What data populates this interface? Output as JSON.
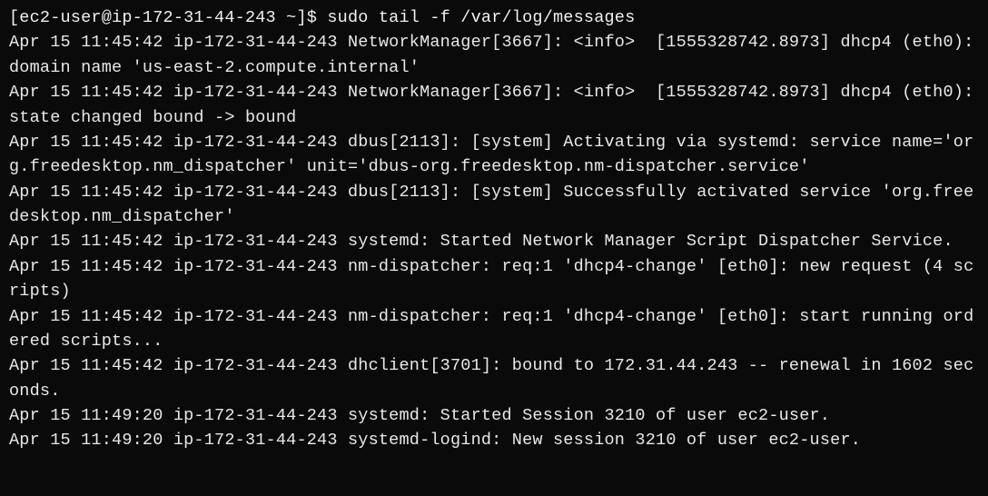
{
  "terminal": {
    "prompt": "[ec2-user@ip-172-31-44-243 ~]$ ",
    "command": "sudo tail -f /var/log/messages",
    "lines": [
      "Apr 15 11:45:42 ip-172-31-44-243 NetworkManager[3667]: <info>  [1555328742.8973] dhcp4 (eth0):   domain name 'us-east-2.compute.internal'",
      "Apr 15 11:45:42 ip-172-31-44-243 NetworkManager[3667]: <info>  [1555328742.8973] dhcp4 (eth0): state changed bound -> bound",
      "Apr 15 11:45:42 ip-172-31-44-243 dbus[2113]: [system] Activating via systemd: service name='org.freedesktop.nm_dispatcher' unit='dbus-org.freedesktop.nm-dispatcher.service'",
      "Apr 15 11:45:42 ip-172-31-44-243 dbus[2113]: [system] Successfully activated service 'org.freedesktop.nm_dispatcher'",
      "Apr 15 11:45:42 ip-172-31-44-243 systemd: Started Network Manager Script Dispatcher Service.",
      "Apr 15 11:45:42 ip-172-31-44-243 nm-dispatcher: req:1 'dhcp4-change' [eth0]: new request (4 scripts)",
      "Apr 15 11:45:42 ip-172-31-44-243 nm-dispatcher: req:1 'dhcp4-change' [eth0]: start running ordered scripts...",
      "Apr 15 11:45:42 ip-172-31-44-243 dhclient[3701]: bound to 172.31.44.243 -- renewal in 1602 seconds.",
      "Apr 15 11:49:20 ip-172-31-44-243 systemd: Started Session 3210 of user ec2-user.",
      "Apr 15 11:49:20 ip-172-31-44-243 systemd-logind: New session 3210 of user ec2-user."
    ]
  }
}
